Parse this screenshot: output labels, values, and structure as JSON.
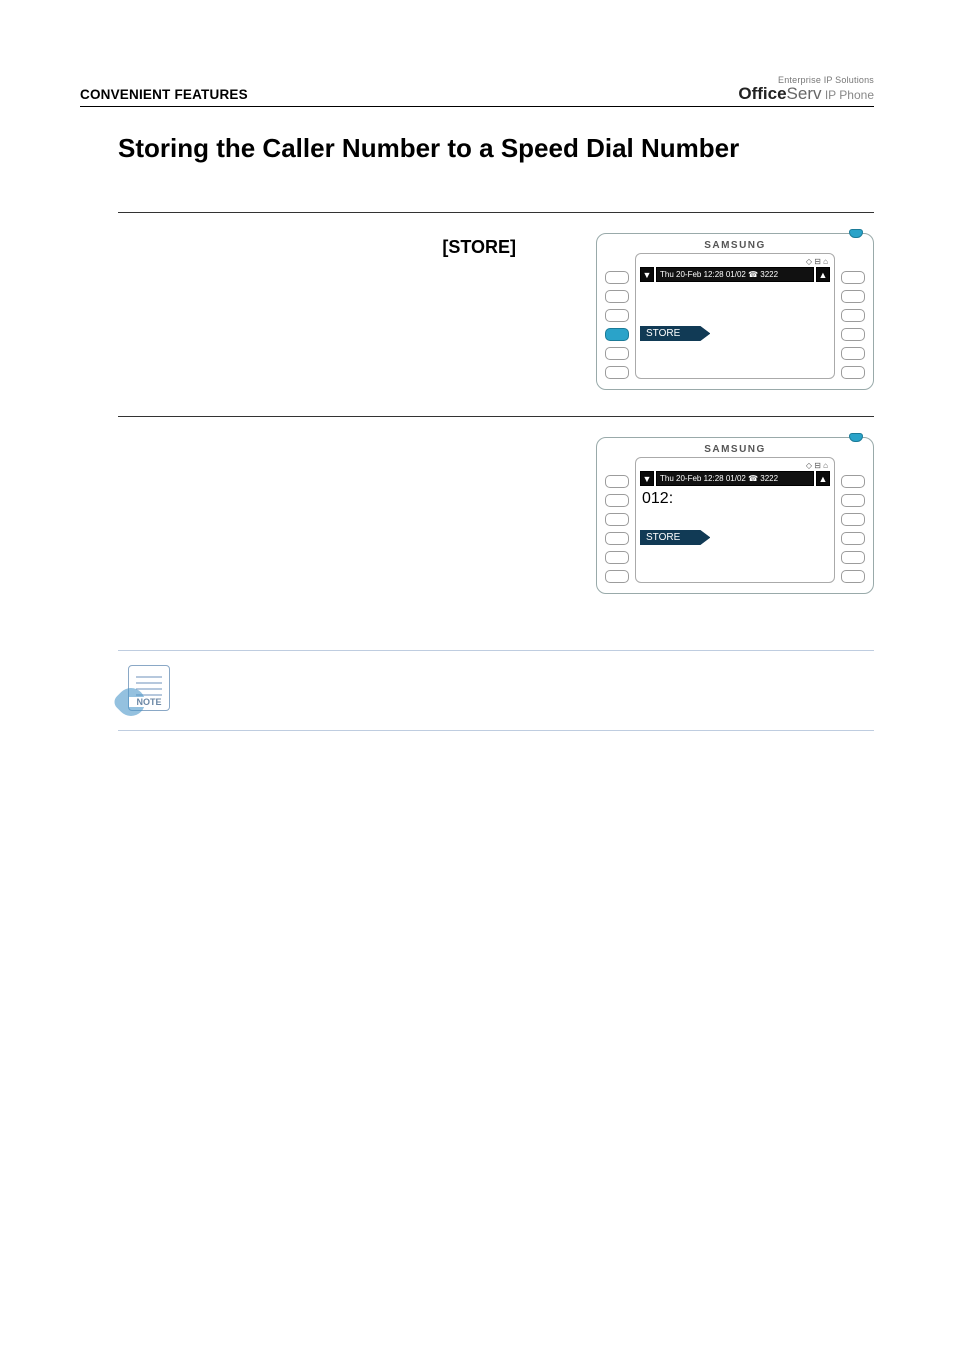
{
  "header": {
    "section": "CONVENIENT FEATURES",
    "brand_top": "Enterprise IP Solutions",
    "brand_main_bold": "Office",
    "brand_main_light": "Serv",
    "brand_suffix": " IP Phone"
  },
  "title": "Storing the Caller Number to a Speed Dial Number",
  "rows": [
    {
      "left_label": "[STORE]",
      "phone": {
        "brand": "SAMSUNG",
        "status_icons": "◇ ⊟ ⌂",
        "info_line": "Thu 20-Feb 12:28  01/02 ☎ 3222",
        "arrow_left": "▼",
        "arrow_right": "▲",
        "line2": "",
        "store_tag": "STORE",
        "left_buttons_active_index": 3
      }
    },
    {
      "left_label": "",
      "phone": {
        "brand": "SAMSUNG",
        "status_icons": "◇ ⊟ ⌂",
        "info_line": "Thu 20-Feb 12:28  01/02 ☎ 3222",
        "arrow_left": "▼",
        "arrow_right": "▲",
        "line2": "012:",
        "store_tag": "STORE",
        "left_buttons_active_index": -1
      }
    }
  ],
  "note": {
    "label": "NOTE"
  }
}
